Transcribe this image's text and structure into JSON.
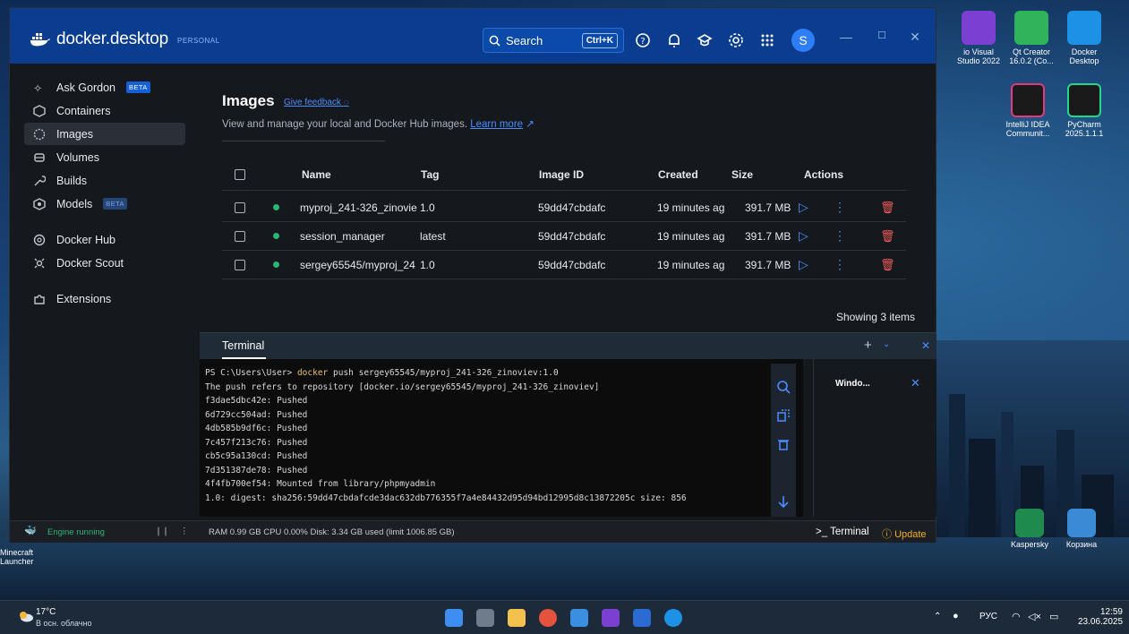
{
  "app": {
    "logo_text": "docker.desktop",
    "plan": "PERSONAL",
    "search_label": "Search",
    "search_shortcut": "Ctrl+K",
    "avatar_letter": "S"
  },
  "sidebar": {
    "items": [
      {
        "label": "Ask Gordon",
        "badge": "BETA"
      },
      {
        "label": "Containers"
      },
      {
        "label": "Images"
      },
      {
        "label": "Volumes"
      },
      {
        "label": "Builds"
      },
      {
        "label": "Models",
        "badge": "BETA"
      },
      {
        "label": "Docker Hub"
      },
      {
        "label": "Docker Scout"
      },
      {
        "label": "Extensions"
      }
    ]
  },
  "images": {
    "title": "Images",
    "feedback": "Give feedback",
    "subtitle": "View and manage your local and Docker Hub images.",
    "learn_more": "Learn more",
    "columns": {
      "name": "Name",
      "tag": "Tag",
      "id": "Image ID",
      "created": "Created",
      "size": "Size",
      "actions": "Actions"
    },
    "rows": [
      {
        "name": "myproj_241-326_zinovie",
        "tag": "1.0",
        "id": "59dd47cbdafc",
        "created": "19 minutes ag",
        "size": "391.7 MB"
      },
      {
        "name": "session_manager",
        "tag": "latest",
        "id": "59dd47cbdafc",
        "created": "19 minutes ag",
        "size": "391.7 MB"
      },
      {
        "name": "sergey65545/myproj_24",
        "tag": "1.0",
        "id": "59dd47cbdafc",
        "created": "19 minutes ag",
        "size": "391.7 MB"
      }
    ],
    "showing": "Showing 3 items"
  },
  "terminal": {
    "tab": "Terminal",
    "prompt": "PS C:\\Users\\User> ",
    "command_kw": "docker",
    "command_rest": " push sergey65545/myproj_241-326_zinoviev:1.0",
    "lines": [
      "The push refers to repository [docker.io/sergey65545/myproj_241-326_zinoviev]",
      "f3dae5dbc42e: Pushed",
      "6d729cc504ad: Pushed",
      "4db585b9df6c: Pushed",
      "7c457f213c76: Pushed",
      "cb5c95a130cd: Pushed",
      "7d351387de78: Pushed",
      "4f4fb700ef54: Mounted from library/phpmyadmin",
      "1.0: digest: sha256:59dd47cbdafcde3dac632db776355f7a4e84432d95d94bd12995d8c13872205c size: 856"
    ],
    "side_title": "Windo..."
  },
  "status": {
    "engine": "Engine running",
    "resources": "RAM 0.99 GB  CPU 0.00%   Disk: 3.34 GB used (limit 1006.85 GB)",
    "terminal": ">_ Terminal",
    "update": "Update"
  },
  "desktop": {
    "icons": [
      {
        "label": "io Visual Studio 2022",
        "color": "#7b3fd1"
      },
      {
        "label": "Qt Creator 16.0.2 (Co...",
        "color": "#2fb45a"
      },
      {
        "label": "Docker Desktop",
        "color": "#1d91e6"
      },
      {
        "label": "IntelliJ IDEA Communit...",
        "color": "#1a1a1a"
      },
      {
        "label": "PyCharm 2025.1.1.1",
        "color": "#1a1a1a"
      },
      {
        "label": "Kaspersky",
        "color": "#1f8a4d"
      },
      {
        "label": "Корзина",
        "color": "#3a8ad6"
      }
    ],
    "mini": [
      "Minecraft Launcher"
    ]
  },
  "taskbar": {
    "temp": "17°C",
    "weather": "В осн. облачно",
    "lang": "РУС",
    "time": "12:59",
    "date": "23.06.2025"
  }
}
